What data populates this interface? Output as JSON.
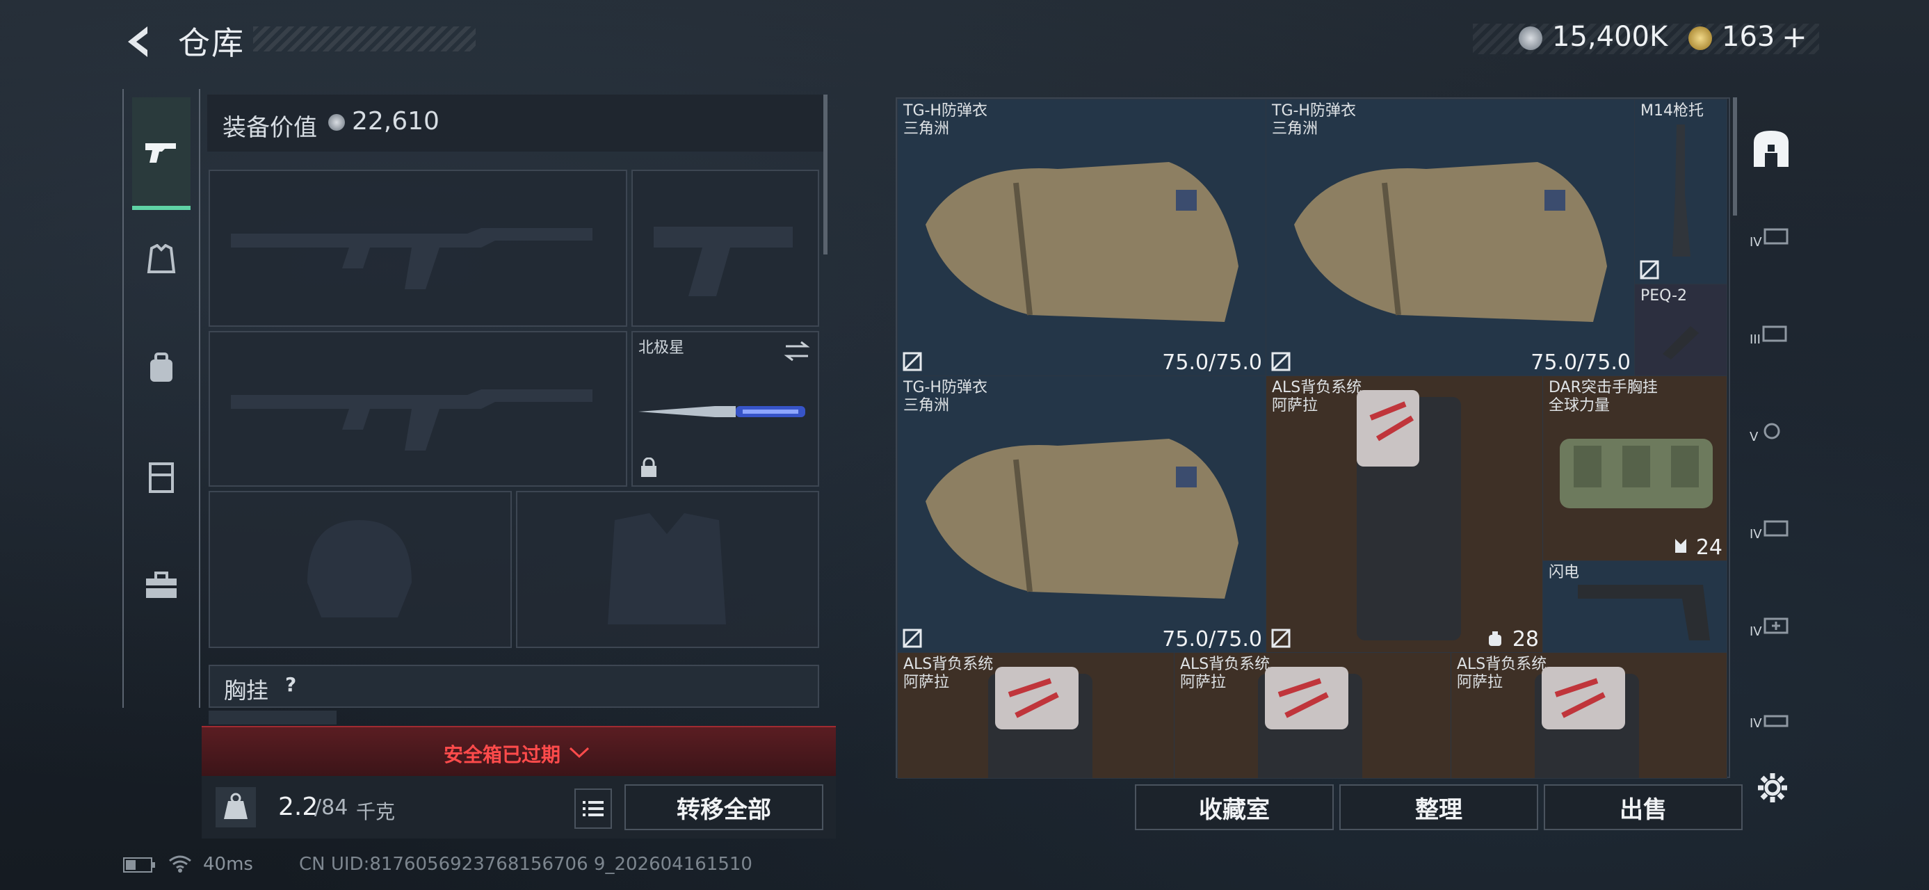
{
  "header": {
    "title": "仓库",
    "currency_a": "15,400K",
    "currency_b": "163",
    "add_glyph": "+"
  },
  "loadout": {
    "value_label": "装备价值",
    "value": "22,610",
    "knife_name": "北极星",
    "chest_label": "胸挂",
    "help_glyph": "?",
    "safe_box": "安全箱已过期",
    "weight_current": "2.2",
    "weight_max": "/84",
    "weight_unit": "千克",
    "transfer_all": "转移全部"
  },
  "grid_items": [
    {
      "name": "TG-H防弹衣",
      "sub": "三角洲",
      "value": "75.0/75.0"
    },
    {
      "name": "TG-H防弹衣",
      "sub": "三角洲",
      "value": "75.0/75.0"
    },
    {
      "name": "M14枪托",
      "sub": "",
      "value": ""
    },
    {
      "name": "PEQ-2",
      "sub": "",
      "value": ""
    },
    {
      "name": "TG-H防弹衣",
      "sub": "三角洲",
      "value": "75.0/75.0"
    },
    {
      "name": "ALS背负系统",
      "sub": "阿萨拉",
      "value": "28"
    },
    {
      "name": "DAR突击手胸挂",
      "sub": "全球力量",
      "value": "24"
    },
    {
      "name": "闪电",
      "sub": "",
      "value": ""
    },
    {
      "name": "ALS背负系统",
      "sub": "阿萨拉",
      "value": ""
    },
    {
      "name": "ALS背负系统",
      "sub": "阿萨拉",
      "value": ""
    },
    {
      "name": "ALS背负系统",
      "sub": "阿萨拉",
      "value": ""
    }
  ],
  "rail_tiers": [
    "IV",
    "III",
    "V",
    "IV",
    "IV",
    "IV"
  ],
  "actions": {
    "collection": "收藏室",
    "organize": "整理",
    "sell": "出售"
  },
  "status": {
    "ping": "40ms",
    "uid": "CN UID:8176056923768156706 9_202604161510"
  },
  "colors": {
    "accent_green": "#5fd3a5",
    "alert_red": "#e23b3b",
    "cell_blue": "#243648",
    "cell_brown": "#3e3026"
  }
}
